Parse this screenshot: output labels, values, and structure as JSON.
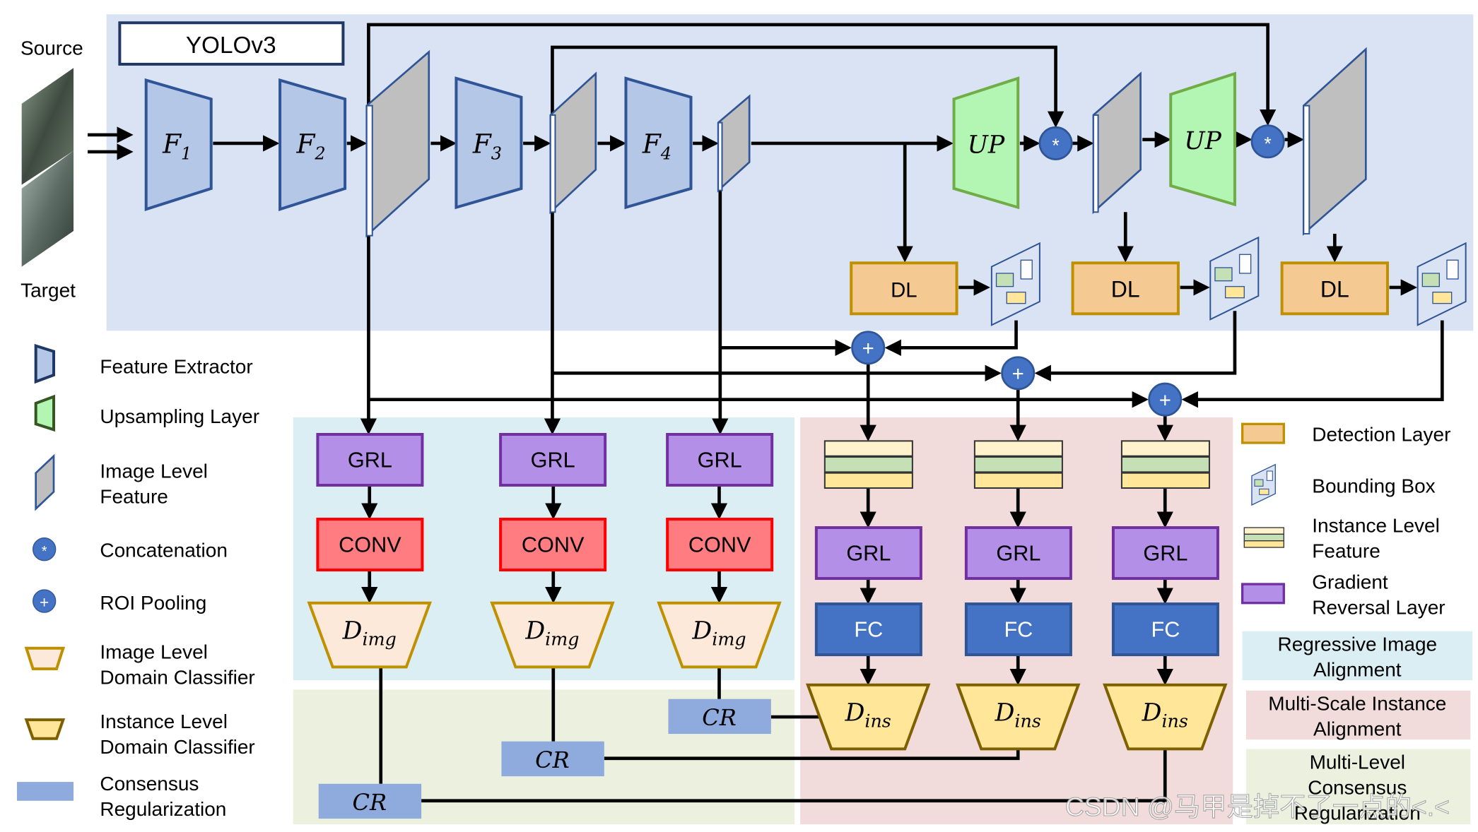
{
  "header": {
    "title": "YOLOv3",
    "source_label": "Source",
    "target_label": "Target"
  },
  "extractors": [
    {
      "base": "F",
      "sub": "1"
    },
    {
      "base": "F",
      "sub": "2"
    },
    {
      "base": "F",
      "sub": "3"
    },
    {
      "base": "F",
      "sub": "4"
    }
  ],
  "upsampling_label": "UP",
  "concat_symbol": "*",
  "roi_symbol": "+",
  "detection_label": "DL",
  "grl_label": "GRL",
  "conv_label": "CONV",
  "fc_label": "FC",
  "cr_label": "CR",
  "d_img": {
    "base": "D",
    "sub": "img"
  },
  "d_ins": {
    "base": "D",
    "sub": "ins"
  },
  "legend_left": [
    {
      "icon": "feature-extractor-icon",
      "text1": "Feature Extractor",
      "text2": ""
    },
    {
      "icon": "upsampling-icon",
      "text1": "Upsampling Layer",
      "text2": ""
    },
    {
      "icon": "image-feature-icon",
      "text1": "Image Level",
      "text2": "Feature"
    },
    {
      "icon": "concatenation-icon",
      "text1": "Concatenation",
      "text2": ""
    },
    {
      "icon": "roi-pooling-icon",
      "text1": "ROI Pooling",
      "text2": ""
    },
    {
      "icon": "image-classifier-icon",
      "text1": "Image Level",
      "text2": "Domain Classifier"
    },
    {
      "icon": "instance-classifier-icon",
      "text1": "Instance Level",
      "text2": "Domain Classifier"
    },
    {
      "icon": "consensus-icon",
      "text1": "Consensus",
      "text2": "Regularization"
    }
  ],
  "legend_right": [
    {
      "icon": "detection-layer-icon",
      "text1": "Detection Layer",
      "text2": ""
    },
    {
      "icon": "bounding-box-icon",
      "text1": "Bounding Box",
      "text2": ""
    },
    {
      "icon": "instance-feature-icon",
      "text1": "Instance Level",
      "text2": "Feature"
    },
    {
      "icon": "grl-icon",
      "text1": "Gradient",
      "text2": "Reversal Layer"
    }
  ],
  "region_legend": [
    {
      "text1": "Regressive Image",
      "text2": "Alignment",
      "text3": ""
    },
    {
      "text1": "Multi-Scale Instance",
      "text2": "Alignment",
      "text3": ""
    },
    {
      "text1": "Multi-Level",
      "text2": "Consensus",
      "text3": "Regularization"
    }
  ],
  "watermark": "CSDN @马甲是掉不了一点的<.<",
  "colors": {
    "backbone_bg": "#dae3f3",
    "image_align_bg": "#dbeef4",
    "instance_align_bg": "#f2dcdb",
    "consensus_bg": "#ebf1de",
    "grl": "#b48fe8",
    "conv": "#ff7c80",
    "fc": "#4472c4",
    "cr": "#8faadc",
    "detection": "#f5c992",
    "upsampling": "#b3f5b3"
  }
}
